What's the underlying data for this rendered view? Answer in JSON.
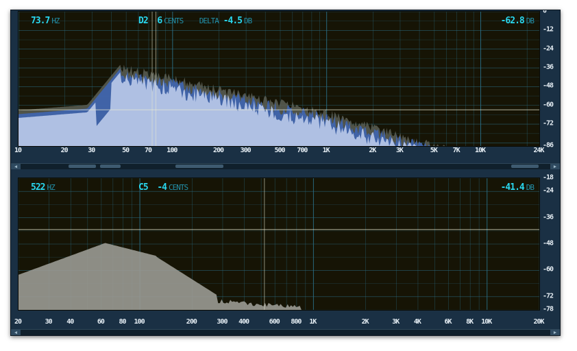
{
  "top_panel": {
    "freq_value": "73.7",
    "freq_unit": "HZ",
    "note": "D2",
    "cents_value": "6",
    "cents_unit": "CENTS",
    "delta_label": "DELTA",
    "delta_value": "-4.5",
    "delta_unit": "DB",
    "level_value": "-62.8",
    "level_unit": "DB",
    "x_ticks": [
      "10",
      "20",
      "30",
      "50",
      "70",
      "100",
      "200",
      "300",
      "500",
      "700",
      "1K",
      "2K",
      "3K",
      "5K",
      "7K",
      "10K",
      "24K"
    ],
    "y_ticks": [
      "0",
      "-12",
      "-24",
      "-36",
      "-48",
      "-60",
      "-72",
      "-86"
    ]
  },
  "bottom_panel": {
    "freq_value": "522",
    "freq_unit": "HZ",
    "note": "C5",
    "cents_value": "-4",
    "cents_unit": "CENTS",
    "level_value": "-41.4",
    "level_unit": "DB",
    "x_ticks": [
      "20",
      "30",
      "40",
      "60",
      "80",
      "100",
      "200",
      "300",
      "400",
      "600",
      "800",
      "1K",
      "2K",
      "3K",
      "4K",
      "6K",
      "8K",
      "10K",
      "20K"
    ],
    "y_ticks": [
      "-18",
      "-24",
      "-36",
      "-48",
      "-60",
      "-72",
      "-78"
    ]
  },
  "colors": {
    "readout": "#29d8f0",
    "grid": "#2a6f88",
    "spectrum_fill": "#b8c8e8",
    "spectrum_fill_bottom": "#9a9a94",
    "background": "#161405"
  }
}
